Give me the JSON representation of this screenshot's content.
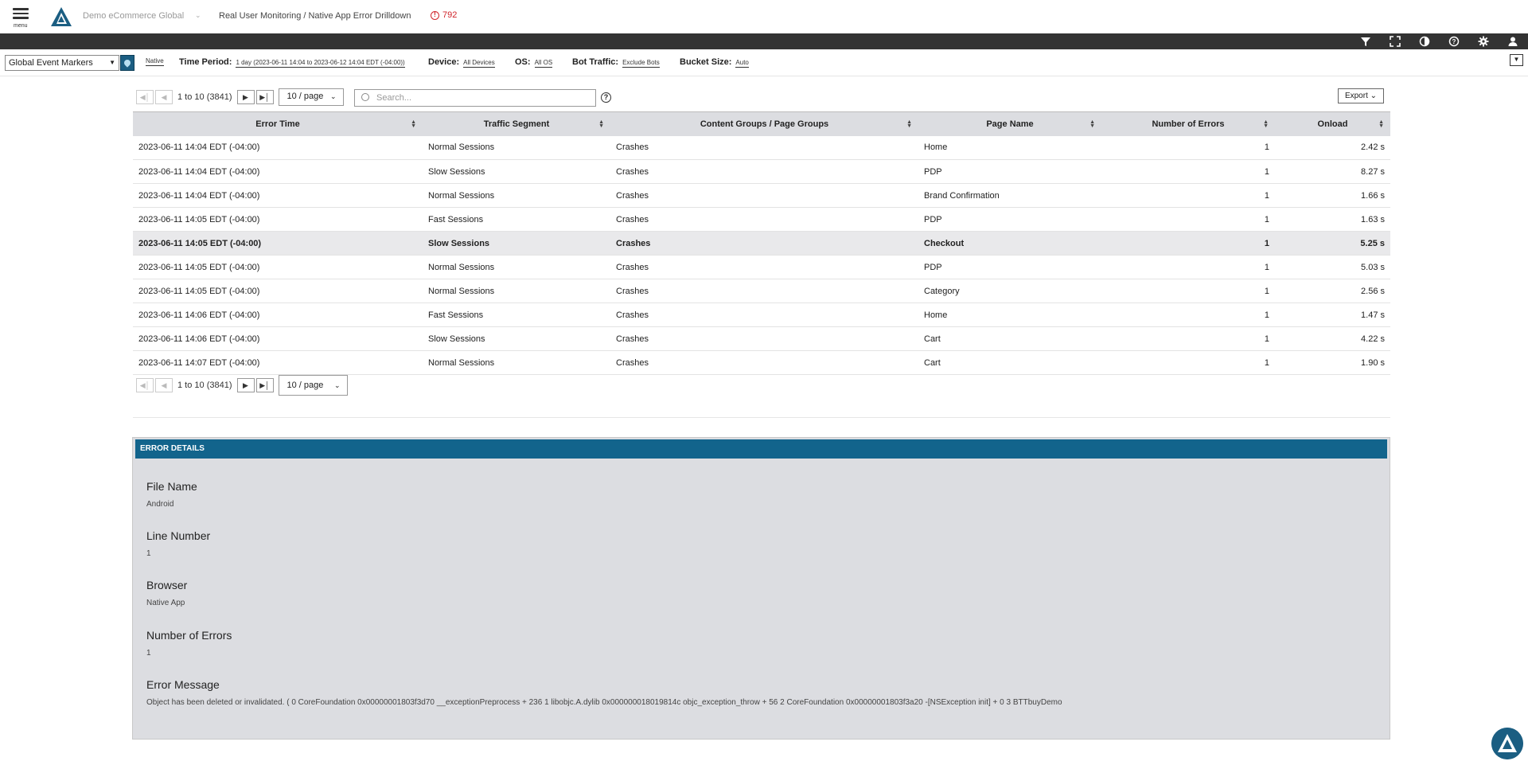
{
  "header": {
    "menu_label": "menu",
    "app_name": "Demo eCommerce Global",
    "breadcrumb": "Real User Monitoring / Native App Error Drilldown",
    "alert_count": "792"
  },
  "toolbar": {
    "icons": [
      "filter-icon",
      "fullscreen-icon",
      "contrast-icon",
      "help-icon",
      "settings-icon",
      "user-icon"
    ]
  },
  "filters": {
    "event_markers": "Global Event Markers",
    "native": "Native",
    "time_period_label": "Time Period:",
    "time_period_value": "1 day (2023-06-11 14:04 to 2023-06-12 14:04 EDT (-04:00))",
    "device_label": "Device:",
    "device_value": "All Devices",
    "os_label": "OS:",
    "os_value": "All OS",
    "bot_label": "Bot Traffic:",
    "bot_value": "Exclude Bots",
    "bucket_label": "Bucket Size:",
    "bucket_value": "Auto"
  },
  "pagination": {
    "range": "1 to 10 (3841)",
    "per_page": "10 / page",
    "search_placeholder": "Search...",
    "export_label": "Export"
  },
  "table": {
    "columns": [
      "Error Time",
      "Traffic Segment",
      "Content Groups / Page Groups",
      "Page Name",
      "Number of Errors",
      "Onload"
    ],
    "rows": [
      [
        "2023-06-11 14:04 EDT (-04:00)",
        "Normal Sessions",
        "Crashes",
        "Home",
        "1",
        "2.42 s"
      ],
      [
        "2023-06-11 14:04 EDT (-04:00)",
        "Slow Sessions",
        "Crashes",
        "PDP",
        "1",
        "8.27 s"
      ],
      [
        "2023-06-11 14:04 EDT (-04:00)",
        "Normal Sessions",
        "Crashes",
        "Brand Confirmation",
        "1",
        "1.66 s"
      ],
      [
        "2023-06-11 14:05 EDT (-04:00)",
        "Fast Sessions",
        "Crashes",
        "PDP",
        "1",
        "1.63 s"
      ],
      [
        "2023-06-11 14:05 EDT (-04:00)",
        "Slow Sessions",
        "Crashes",
        "Checkout",
        "1",
        "5.25 s"
      ],
      [
        "2023-06-11 14:05 EDT (-04:00)",
        "Normal Sessions",
        "Crashes",
        "PDP",
        "1",
        "5.03 s"
      ],
      [
        "2023-06-11 14:05 EDT (-04:00)",
        "Normal Sessions",
        "Crashes",
        "Category",
        "1",
        "2.56 s"
      ],
      [
        "2023-06-11 14:06 EDT (-04:00)",
        "Fast Sessions",
        "Crashes",
        "Home",
        "1",
        "1.47 s"
      ],
      [
        "2023-06-11 14:06 EDT (-04:00)",
        "Slow Sessions",
        "Crashes",
        "Cart",
        "1",
        "4.22 s"
      ],
      [
        "2023-06-11 14:07 EDT (-04:00)",
        "Normal Sessions",
        "Crashes",
        "Cart",
        "1",
        "1.90 s"
      ]
    ],
    "selected_row": 4
  },
  "details": {
    "title": "ERROR DETAILS",
    "fields": [
      {
        "label": "File Name",
        "value": "Android"
      },
      {
        "label": "Line Number",
        "value": "1"
      },
      {
        "label": "Browser",
        "value": "Native App"
      },
      {
        "label": "Number of Errors",
        "value": "1"
      },
      {
        "label": "Error Message",
        "value": "Object has been deleted or invalidated. ( 0 CoreFoundation 0x00000001803f3d70 __exceptionPreprocess + 236 1 libobjc.A.dylib 0x000000018019814c objc_exception_throw + 56 2 CoreFoundation 0x00000001803f3a20 -[NSException init] + 0 3 BTTbuyDemo"
      }
    ]
  },
  "colors": {
    "header_bar": "#333333",
    "accent": "#12648c",
    "alert": "#d0242a",
    "table_header": "#dcdde1"
  }
}
